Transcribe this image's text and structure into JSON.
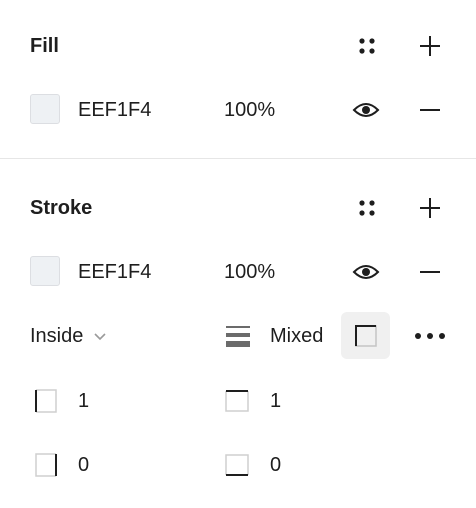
{
  "fill": {
    "title": "Fill",
    "color_hex": "EEF1F4",
    "swatch_color": "#EEF1F4",
    "opacity": "100%",
    "icons": {
      "styles": "styles-grid-icon",
      "add": "plus-icon",
      "visibility": "eye-icon",
      "remove": "minus-icon"
    }
  },
  "stroke": {
    "title": "Stroke",
    "color_hex": "EEF1F4",
    "swatch_color": "#EEF1F4",
    "opacity": "100%",
    "position": "Inside",
    "weight": "Mixed",
    "sides": {
      "left": "1",
      "top": "1",
      "right": "0",
      "bottom": "0"
    },
    "icons": {
      "styles": "styles-grid-icon",
      "add": "plus-icon",
      "visibility": "eye-icon",
      "remove": "minus-icon",
      "position_dropdown": "chevron-down-icon",
      "weight": "stroke-weight-icon",
      "individual_strokes": "individual-strokes-icon",
      "more": "more-options-icon"
    }
  }
}
